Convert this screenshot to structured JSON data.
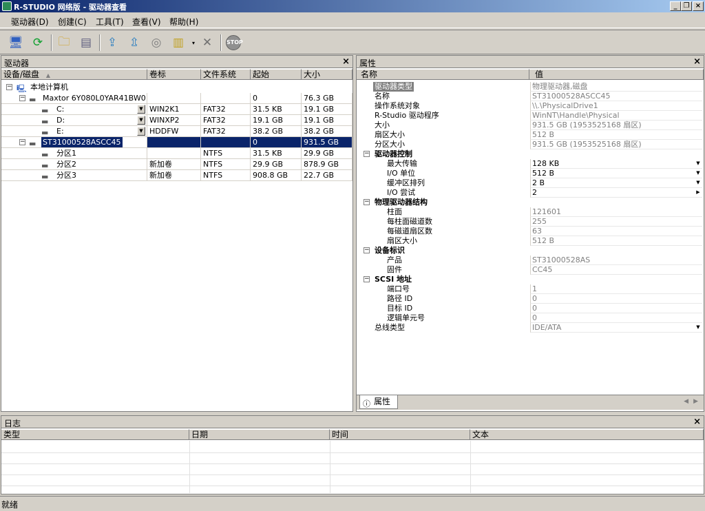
{
  "window": {
    "title": "R-STUDIO 网络版 - 驱动器查看"
  },
  "menu": [
    {
      "label": "驱动器(D)"
    },
    {
      "label": "创建(C)"
    },
    {
      "label": "工具(T)"
    },
    {
      "label": "查看(V)"
    },
    {
      "label": "帮助(H)"
    }
  ],
  "toolbar": {
    "icons": [
      "connect-icon",
      "refresh-icon",
      "open-image-icon",
      "scan-icon",
      "recover-icon",
      "recover-marked-icon",
      "create-image-icon",
      "region-icon",
      "dropdown-icon",
      "delete-icon",
      "stop-icon"
    ]
  },
  "drives_panel": {
    "title": "驱动器",
    "columns": [
      "设备/磁盘",
      "卷标",
      "文件系统",
      "起始",
      "大小"
    ],
    "rows": [
      {
        "name": "本地计算机",
        "label": "",
        "fs": "",
        "start": "",
        "size": ""
      },
      {
        "name": "Maxtor 6Y080L0YAR41BW0",
        "label": "",
        "fs": "",
        "start": "0",
        "size": "76.3 GB"
      },
      {
        "name": "C:",
        "label": "WIN2K1",
        "fs": "FAT32",
        "start": "31.5 KB",
        "size": "19.1 GB"
      },
      {
        "name": "D:",
        "label": "WINXP2",
        "fs": "FAT32",
        "start": "19.1 GB",
        "size": "19.1 GB"
      },
      {
        "name": "E:",
        "label": "HDDFW",
        "fs": "FAT32",
        "start": "38.2 GB",
        "size": "38.2 GB"
      },
      {
        "name": "ST31000528ASCC45",
        "label": "",
        "fs": "",
        "start": "0",
        "size": "931.5 GB"
      },
      {
        "name": "分区1",
        "label": "",
        "fs": "NTFS",
        "start": "31.5 KB",
        "size": "29.9 GB"
      },
      {
        "name": "分区2",
        "label": "新加卷",
        "fs": "NTFS",
        "start": "29.9 GB",
        "size": "878.9 GB"
      },
      {
        "name": "分区3",
        "label": "新加卷",
        "fs": "NTFS",
        "start": "908.8 GB",
        "size": "22.7 GB"
      }
    ]
  },
  "properties_panel": {
    "title": "属性",
    "columns": [
      "名称",
      "值"
    ],
    "tab": "属性",
    "rows": [
      {
        "name": "驱动器类型",
        "value": "物理驱动器,磁盘"
      },
      {
        "name": "名称",
        "value": "ST31000528ASCC45"
      },
      {
        "name": "操作系统对象",
        "value": "\\\\.\\PhysicalDrive1"
      },
      {
        "name": "R-Studio 驱动程序",
        "value": "WinNT\\Handle\\Physical"
      },
      {
        "name": "大小",
        "value": "931.5 GB (1953525168 扇区)"
      },
      {
        "name": "扇区大小",
        "value": "512 B"
      },
      {
        "name": "分区大小",
        "value": "931.5 GB (1953525168 扇区)"
      },
      {
        "name": "驱动器控制",
        "value": ""
      },
      {
        "name": "最大传输",
        "value": "128 KB"
      },
      {
        "name": "I/O 单位",
        "value": "512 B"
      },
      {
        "name": "缓冲区排列",
        "value": "2 B"
      },
      {
        "name": "I/O 尝试",
        "value": "2"
      },
      {
        "name": "物理驱动器结构",
        "value": ""
      },
      {
        "name": "柱面",
        "value": "121601"
      },
      {
        "name": "每柱面磁道数",
        "value": "255"
      },
      {
        "name": "每磁道扇区数",
        "value": "63"
      },
      {
        "name": "扇区大小",
        "value": "512 B"
      },
      {
        "name": "设备标识",
        "value": ""
      },
      {
        "name": "产品",
        "value": "ST31000528AS"
      },
      {
        "name": "固件",
        "value": "CC45"
      },
      {
        "name": "SCSI 地址",
        "value": ""
      },
      {
        "name": "端口号",
        "value": "1"
      },
      {
        "name": "路径 ID",
        "value": "0"
      },
      {
        "name": "目标 ID",
        "value": "0"
      },
      {
        "name": "逻辑单元号",
        "value": "0"
      },
      {
        "name": "总线类型",
        "value": "IDE/ATA"
      }
    ]
  },
  "log_panel": {
    "title": "日志",
    "columns": [
      "类型",
      "日期",
      "时间",
      "文本"
    ]
  },
  "status": {
    "text": "就绪"
  },
  "colors": {
    "selection": "#0a246a",
    "face": "#d4d0c8"
  }
}
